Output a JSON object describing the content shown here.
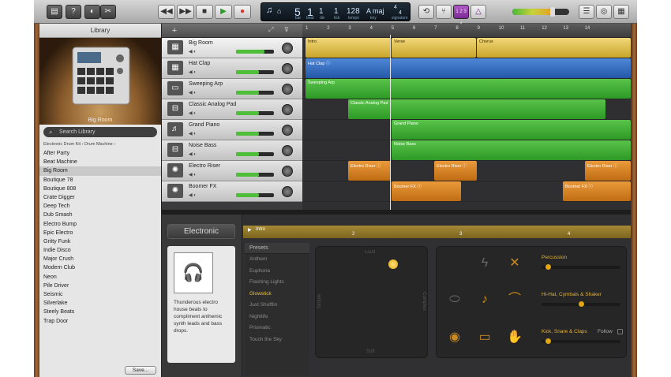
{
  "toolbar": {
    "lcd": {
      "bar": "5",
      "beat": "1",
      "div": "1",
      "tick": "1",
      "tempo": "128",
      "key": "A maj",
      "sig_top": "4",
      "sig_bottom": "4",
      "labels": {
        "bar": "bar",
        "beat": "beat",
        "div": "div",
        "tick": "tick",
        "tempo": "tempo",
        "key": "key",
        "sig": "signature"
      }
    },
    "count_in": "1 2 3 4"
  },
  "library": {
    "title": "Library",
    "image_caption": "Big Room",
    "search_placeholder": "Search Library",
    "breadcrumb": [
      "Electronic Drum Kit",
      "Drum Machine"
    ],
    "items": [
      "After Party",
      "Beat Machine",
      "Big Room",
      "Boutique 78",
      "Boutique 808",
      "Crate Digger",
      "Deep Tech",
      "Dub Smash",
      "Electro Bump",
      "Epic Electro",
      "Gritty Funk",
      "Indie Disco",
      "Major Crush",
      "Modern Club",
      "Neon",
      "Pile Driver",
      "Seismic",
      "Silverlake",
      "Steely Beats",
      "Trap Door"
    ],
    "selected": "Big Room",
    "save_label": "Save..."
  },
  "tracks": [
    {
      "name": "Big Room",
      "icon": "drum-machine-icon",
      "volume": 0.75
    },
    {
      "name": "Hat Clap",
      "icon": "drum-machine-icon",
      "volume": 0.6
    },
    {
      "name": "Sweeping Arp",
      "icon": "keyboard-icon",
      "volume": 0.6
    },
    {
      "name": "Classic Analog Pad",
      "icon": "synth-icon",
      "volume": 0.6
    },
    {
      "name": "Grand Piano",
      "icon": "piano-icon",
      "volume": 0.6
    },
    {
      "name": "Noise Bass",
      "icon": "synth-icon",
      "volume": 0.6
    },
    {
      "name": "Electro Riser",
      "icon": "sparkle-icon",
      "volume": 0.6
    },
    {
      "name": "Boomer FX",
      "icon": "sparkle-icon",
      "volume": 0.6
    }
  ],
  "ruler": {
    "marks": [
      "1",
      "2",
      "3",
      "4",
      "5",
      "6",
      "7",
      "8",
      "9",
      "10",
      "11",
      "12",
      "13",
      "14"
    ]
  },
  "regions": {
    "intro": "Intro",
    "verse": "Verse",
    "chorus": "Chorus",
    "hat_clap": "Hat Clap",
    "sweeping_arp": "Sweeping Arp",
    "classic_pad": "Classic Analog Pad",
    "grand_piano": "Grand Piano",
    "noise_bass": "Noise Bass",
    "electro_riser": "Electro Riser",
    "boomer_fx": "Boomer FX"
  },
  "editor": {
    "kit_title": "Electronic",
    "description": "Thunderous electro house beats to compliment anthemic synth leads and bass drops.",
    "region_name": "Intro",
    "ruler": [
      "2",
      "3",
      "4"
    ],
    "presets_title": "Presets",
    "presets": [
      "Anthem",
      "Euphoria",
      "Flashing Lights",
      "Glowstick",
      "Just Shufflin",
      "Nightlife",
      "Prismatic",
      "Touch the Sky"
    ],
    "selected_preset": "Glowstick",
    "pad_labels": {
      "top": "Loud",
      "bottom": "Soft",
      "left": "Simple",
      "right": "Complex"
    },
    "instruments": {
      "percussion": "Percussion",
      "hihat": "Hi-Hat, Cymbals & Shaker",
      "kick": "Kick, Snare & Claps",
      "follow": "Follow"
    },
    "levels": {
      "percussion": 0.05,
      "hihat": 0.5,
      "kick": 0.05
    }
  },
  "colors": {
    "green": "#3fae34",
    "blue": "#3a6fc2",
    "orange": "#d98323",
    "yellow": "#e2bd4c"
  }
}
